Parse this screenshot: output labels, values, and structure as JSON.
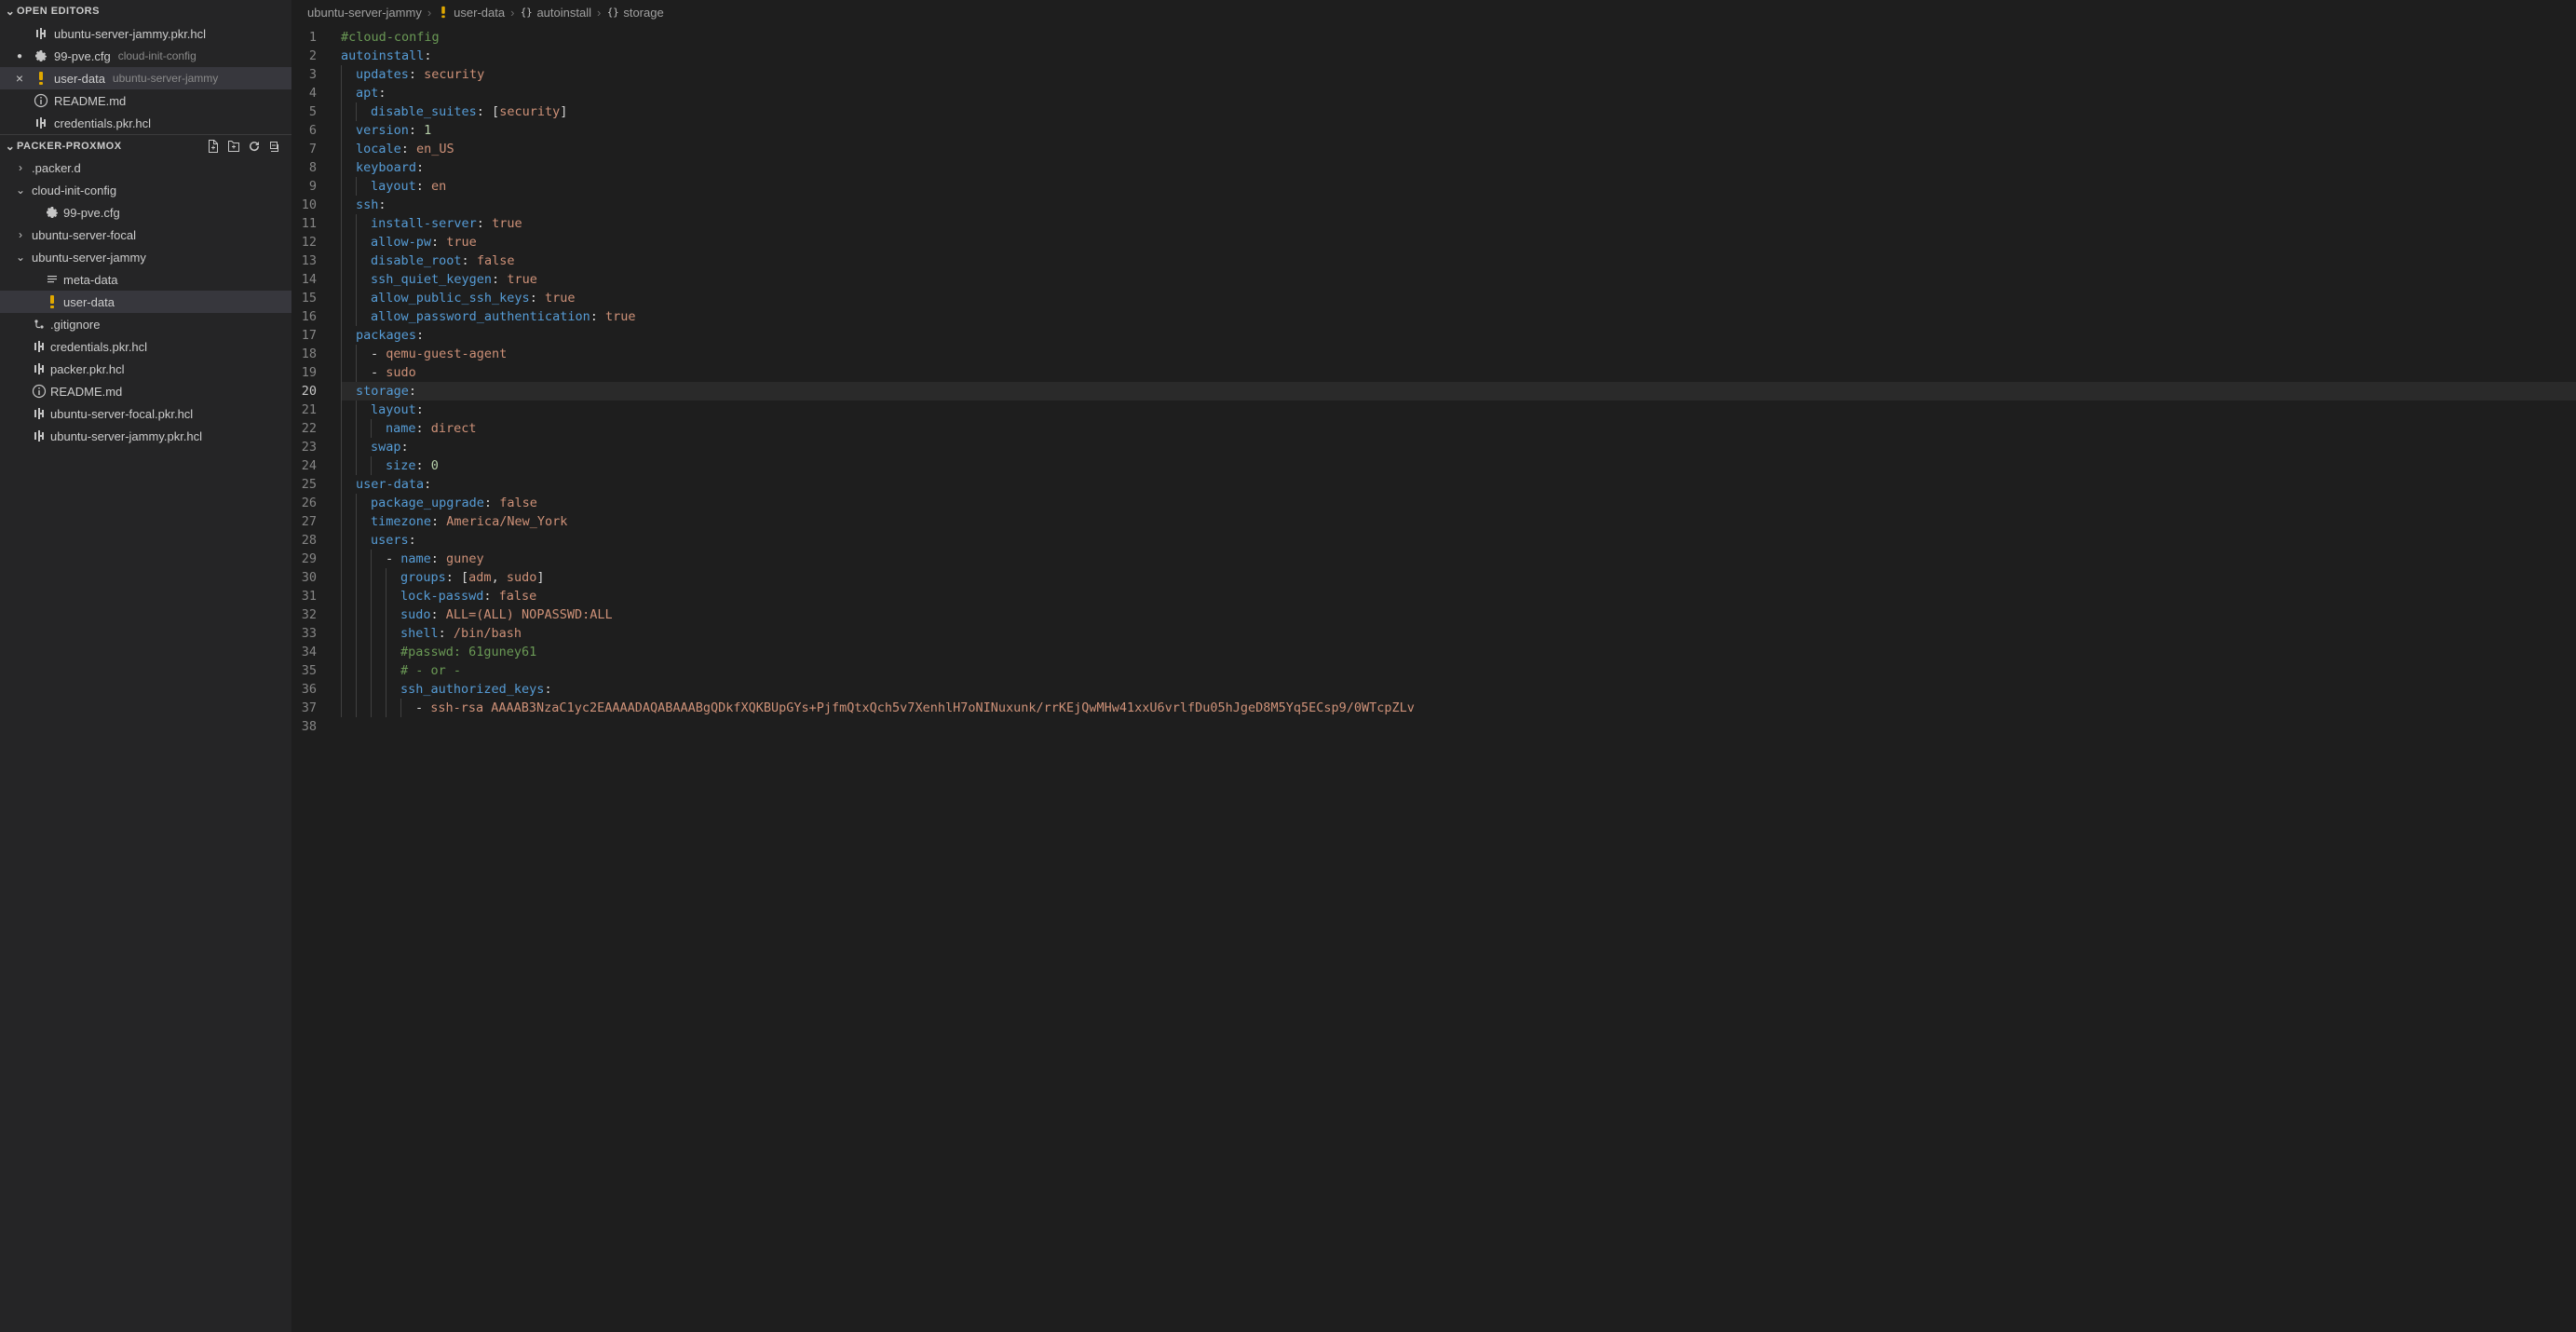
{
  "open_editors": {
    "title": "OPEN EDITORS",
    "items": [
      {
        "name": "ubuntu-server-jammy.pkr.hcl",
        "path": "",
        "icon": "hcl",
        "dirty": false,
        "active": false
      },
      {
        "name": "99-pve.cfg",
        "path": "cloud-init-config",
        "icon": "gear",
        "dirty": true,
        "active": false
      },
      {
        "name": "user-data",
        "path": "ubuntu-server-jammy",
        "icon": "bang",
        "dirty": false,
        "active": true
      },
      {
        "name": "README.md",
        "path": "",
        "icon": "info",
        "dirty": false,
        "active": false
      },
      {
        "name": "credentials.pkr.hcl",
        "path": "",
        "icon": "hcl",
        "dirty": false,
        "active": false
      }
    ]
  },
  "explorer": {
    "title": "PACKER-PROXMOX",
    "tree": [
      {
        "label": ".packer.d",
        "icon": "folder",
        "indent": 1,
        "twisty": "collapsed"
      },
      {
        "label": "cloud-init-config",
        "icon": "folder",
        "indent": 1,
        "twisty": "expanded"
      },
      {
        "label": "99-pve.cfg",
        "icon": "gear",
        "indent": 2,
        "twisty": ""
      },
      {
        "label": "ubuntu-server-focal",
        "icon": "folder",
        "indent": 1,
        "twisty": "collapsed"
      },
      {
        "label": "ubuntu-server-jammy",
        "icon": "folder",
        "indent": 1,
        "twisty": "expanded"
      },
      {
        "label": "meta-data",
        "icon": "lines",
        "indent": 2,
        "twisty": ""
      },
      {
        "label": "user-data",
        "icon": "bang",
        "indent": 2,
        "twisty": "",
        "active": true
      },
      {
        "label": ".gitignore",
        "icon": "git",
        "indent": 1,
        "twisty": ""
      },
      {
        "label": "credentials.pkr.hcl",
        "icon": "hcl",
        "indent": 1,
        "twisty": ""
      },
      {
        "label": "packer.pkr.hcl",
        "icon": "hcl",
        "indent": 1,
        "twisty": ""
      },
      {
        "label": "README.md",
        "icon": "info",
        "indent": 1,
        "twisty": ""
      },
      {
        "label": "ubuntu-server-focal.pkr.hcl",
        "icon": "hcl",
        "indent": 1,
        "twisty": ""
      },
      {
        "label": "ubuntu-server-jammy.pkr.hcl",
        "icon": "hcl",
        "indent": 1,
        "twisty": ""
      }
    ]
  },
  "breadcrumbs": [
    {
      "label": "ubuntu-server-jammy",
      "icon": ""
    },
    {
      "label": "user-data",
      "icon": "bang"
    },
    {
      "label": "autoinstall",
      "icon": "brace"
    },
    {
      "label": "storage",
      "icon": "brace"
    }
  ],
  "editor": {
    "current_line": 20,
    "lines": [
      {
        "n": 1,
        "indent": 0,
        "tokens": [
          {
            "t": "comment",
            "s": "#cloud-config"
          }
        ]
      },
      {
        "n": 2,
        "indent": 0,
        "tokens": [
          {
            "t": "key",
            "s": "autoinstall"
          },
          {
            "t": "punc",
            "s": ":"
          }
        ]
      },
      {
        "n": 3,
        "indent": 1,
        "tokens": [
          {
            "t": "key",
            "s": "updates"
          },
          {
            "t": "punc",
            "s": ": "
          },
          {
            "t": "val",
            "s": "security"
          }
        ]
      },
      {
        "n": 4,
        "indent": 1,
        "tokens": [
          {
            "t": "key",
            "s": "apt"
          },
          {
            "t": "punc",
            "s": ":"
          }
        ]
      },
      {
        "n": 5,
        "indent": 2,
        "tokens": [
          {
            "t": "key",
            "s": "disable_suites"
          },
          {
            "t": "punc",
            "s": ": ["
          },
          {
            "t": "val",
            "s": "security"
          },
          {
            "t": "punc",
            "s": "]"
          }
        ]
      },
      {
        "n": 6,
        "indent": 1,
        "tokens": [
          {
            "t": "key",
            "s": "version"
          },
          {
            "t": "punc",
            "s": ": "
          },
          {
            "t": "num",
            "s": "1"
          }
        ]
      },
      {
        "n": 7,
        "indent": 1,
        "tokens": [
          {
            "t": "key",
            "s": "locale"
          },
          {
            "t": "punc",
            "s": ": "
          },
          {
            "t": "val",
            "s": "en_US"
          }
        ]
      },
      {
        "n": 8,
        "indent": 1,
        "tokens": [
          {
            "t": "key",
            "s": "keyboard"
          },
          {
            "t": "punc",
            "s": ":"
          }
        ]
      },
      {
        "n": 9,
        "indent": 2,
        "tokens": [
          {
            "t": "key",
            "s": "layout"
          },
          {
            "t": "punc",
            "s": ": "
          },
          {
            "t": "val",
            "s": "en"
          }
        ]
      },
      {
        "n": 10,
        "indent": 1,
        "tokens": [
          {
            "t": "key",
            "s": "ssh"
          },
          {
            "t": "punc",
            "s": ":"
          }
        ]
      },
      {
        "n": 11,
        "indent": 2,
        "tokens": [
          {
            "t": "key",
            "s": "install-server"
          },
          {
            "t": "punc",
            "s": ": "
          },
          {
            "t": "val",
            "s": "true"
          }
        ]
      },
      {
        "n": 12,
        "indent": 2,
        "tokens": [
          {
            "t": "key",
            "s": "allow-pw"
          },
          {
            "t": "punc",
            "s": ": "
          },
          {
            "t": "val",
            "s": "true"
          }
        ]
      },
      {
        "n": 13,
        "indent": 2,
        "tokens": [
          {
            "t": "key",
            "s": "disable_root"
          },
          {
            "t": "punc",
            "s": ": "
          },
          {
            "t": "val",
            "s": "false"
          }
        ]
      },
      {
        "n": 14,
        "indent": 2,
        "tokens": [
          {
            "t": "key",
            "s": "ssh_quiet_keygen"
          },
          {
            "t": "punc",
            "s": ": "
          },
          {
            "t": "val",
            "s": "true"
          }
        ]
      },
      {
        "n": 15,
        "indent": 2,
        "tokens": [
          {
            "t": "key",
            "s": "allow_public_ssh_keys"
          },
          {
            "t": "punc",
            "s": ": "
          },
          {
            "t": "val",
            "s": "true"
          }
        ]
      },
      {
        "n": 16,
        "indent": 2,
        "tokens": [
          {
            "t": "key",
            "s": "allow_password_authentication"
          },
          {
            "t": "punc",
            "s": ": "
          },
          {
            "t": "val",
            "s": "true"
          }
        ]
      },
      {
        "n": 17,
        "indent": 1,
        "tokens": [
          {
            "t": "key",
            "s": "packages"
          },
          {
            "t": "punc",
            "s": ":"
          }
        ]
      },
      {
        "n": 18,
        "indent": 2,
        "tokens": [
          {
            "t": "dash",
            "s": "- "
          },
          {
            "t": "val",
            "s": "qemu-guest-agent"
          }
        ]
      },
      {
        "n": 19,
        "indent": 2,
        "tokens": [
          {
            "t": "dash",
            "s": "- "
          },
          {
            "t": "val",
            "s": "sudo"
          }
        ]
      },
      {
        "n": 20,
        "indent": 1,
        "tokens": [
          {
            "t": "key",
            "s": "storage"
          },
          {
            "t": "punc",
            "s": ":"
          }
        ]
      },
      {
        "n": 21,
        "indent": 2,
        "tokens": [
          {
            "t": "key",
            "s": "layout"
          },
          {
            "t": "punc",
            "s": ":"
          }
        ]
      },
      {
        "n": 22,
        "indent": 3,
        "tokens": [
          {
            "t": "key",
            "s": "name"
          },
          {
            "t": "punc",
            "s": ": "
          },
          {
            "t": "val",
            "s": "direct"
          }
        ]
      },
      {
        "n": 23,
        "indent": 2,
        "tokens": [
          {
            "t": "key",
            "s": "swap"
          },
          {
            "t": "punc",
            "s": ":"
          }
        ]
      },
      {
        "n": 24,
        "indent": 3,
        "tokens": [
          {
            "t": "key",
            "s": "size"
          },
          {
            "t": "punc",
            "s": ": "
          },
          {
            "t": "num",
            "s": "0"
          }
        ]
      },
      {
        "n": 25,
        "indent": 1,
        "tokens": [
          {
            "t": "key",
            "s": "user-data"
          },
          {
            "t": "punc",
            "s": ":"
          }
        ]
      },
      {
        "n": 26,
        "indent": 2,
        "tokens": [
          {
            "t": "key",
            "s": "package_upgrade"
          },
          {
            "t": "punc",
            "s": ": "
          },
          {
            "t": "val",
            "s": "false"
          }
        ]
      },
      {
        "n": 27,
        "indent": 2,
        "tokens": [
          {
            "t": "key",
            "s": "timezone"
          },
          {
            "t": "punc",
            "s": ": "
          },
          {
            "t": "val",
            "s": "America/New_York"
          }
        ]
      },
      {
        "n": 28,
        "indent": 2,
        "tokens": [
          {
            "t": "key",
            "s": "users"
          },
          {
            "t": "punc",
            "s": ":"
          }
        ]
      },
      {
        "n": 29,
        "indent": 3,
        "tokens": [
          {
            "t": "dash",
            "s": "- "
          },
          {
            "t": "key",
            "s": "name"
          },
          {
            "t": "punc",
            "s": ": "
          },
          {
            "t": "val",
            "s": "guney"
          }
        ]
      },
      {
        "n": 30,
        "indent": 4,
        "tokens": [
          {
            "t": "key",
            "s": "groups"
          },
          {
            "t": "punc",
            "s": ": ["
          },
          {
            "t": "val",
            "s": "adm"
          },
          {
            "t": "punc",
            "s": ", "
          },
          {
            "t": "val",
            "s": "sudo"
          },
          {
            "t": "punc",
            "s": "]"
          }
        ]
      },
      {
        "n": 31,
        "indent": 4,
        "tokens": [
          {
            "t": "key",
            "s": "lock-passwd"
          },
          {
            "t": "punc",
            "s": ": "
          },
          {
            "t": "val",
            "s": "false"
          }
        ]
      },
      {
        "n": 32,
        "indent": 4,
        "tokens": [
          {
            "t": "key",
            "s": "sudo"
          },
          {
            "t": "punc",
            "s": ": "
          },
          {
            "t": "val",
            "s": "ALL=(ALL) NOPASSWD:ALL"
          }
        ]
      },
      {
        "n": 33,
        "indent": 4,
        "tokens": [
          {
            "t": "key",
            "s": "shell"
          },
          {
            "t": "punc",
            "s": ": "
          },
          {
            "t": "val",
            "s": "/bin/bash"
          }
        ]
      },
      {
        "n": 34,
        "indent": 4,
        "tokens": [
          {
            "t": "comment",
            "s": "#passwd: 61guney61"
          }
        ]
      },
      {
        "n": 35,
        "indent": 4,
        "tokens": [
          {
            "t": "comment",
            "s": "# - or -"
          }
        ]
      },
      {
        "n": 36,
        "indent": 4,
        "tokens": [
          {
            "t": "key",
            "s": "ssh_authorized_keys"
          },
          {
            "t": "punc",
            "s": ":"
          }
        ]
      },
      {
        "n": 37,
        "indent": 5,
        "tokens": [
          {
            "t": "dash",
            "s": "- "
          },
          {
            "t": "val",
            "s": "ssh-rsa AAAAB3NzaC1yc2EAAAADAQABAAABgQDkfXQKBUpGYs+PjfmQtxQch5v7XenhlH7oNINuxunk/rrKEjQwMHw41xxU6vrlfDu05hJgeD8M5Yq5ECsp9/0WTcpZLv"
          }
        ]
      },
      {
        "n": 38,
        "indent": 0,
        "tokens": []
      }
    ]
  }
}
